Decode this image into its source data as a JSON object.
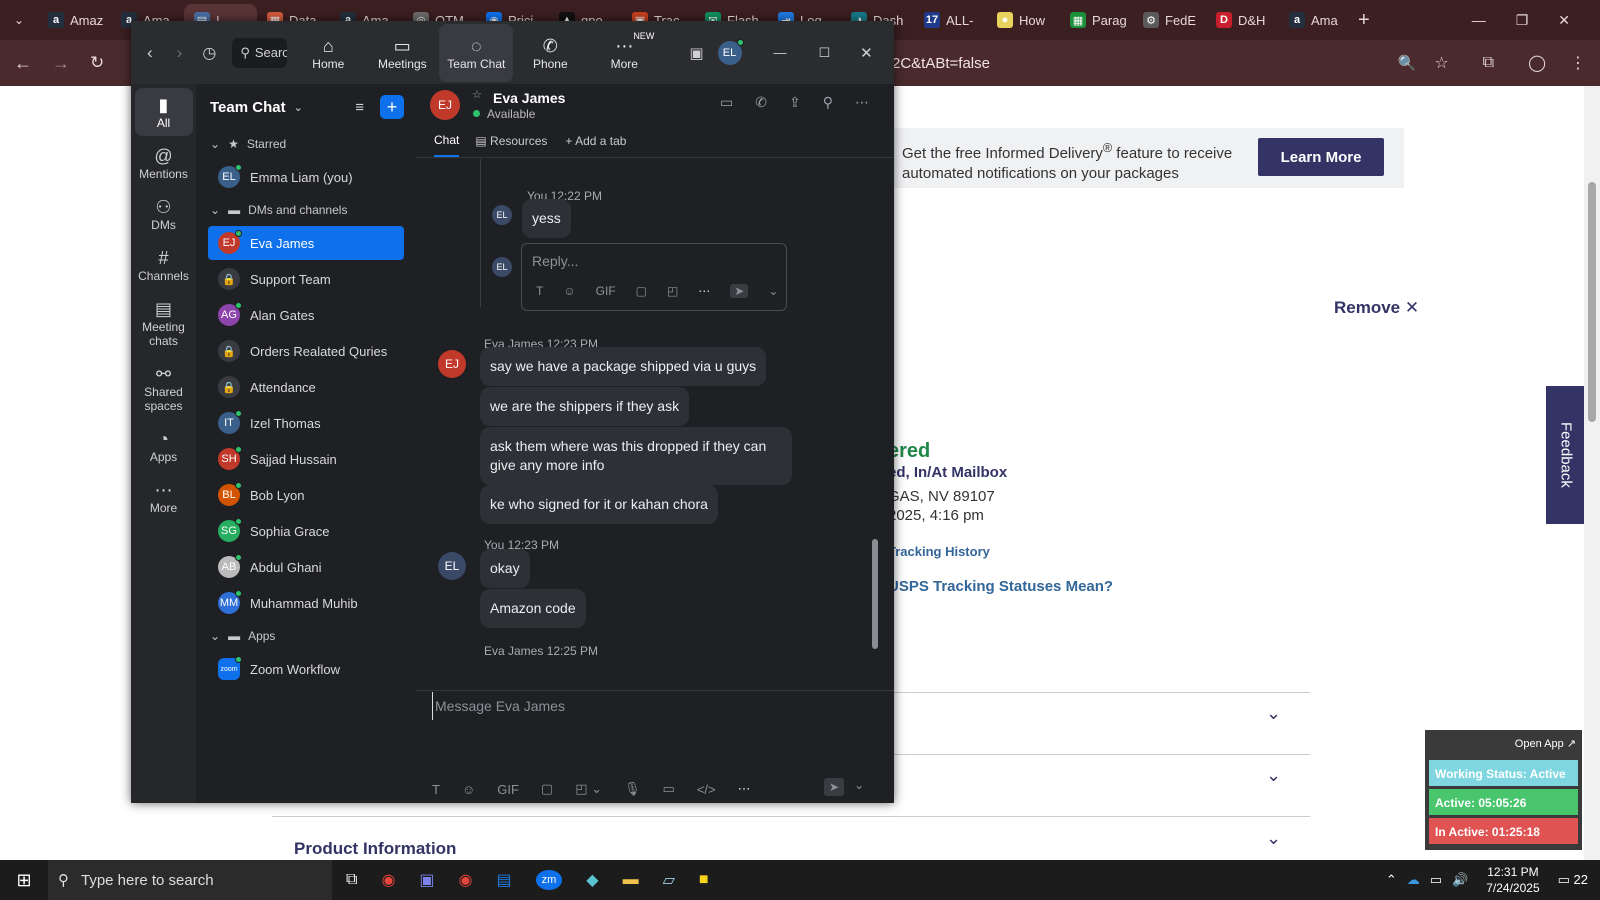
{
  "browser": {
    "tabs": [
      {
        "label": "Amaz",
        "icon": "a",
        "color": "#232f3e"
      },
      {
        "label": "Ama",
        "icon": "a",
        "color": "#232f3e"
      },
      {
        "label": "I",
        "icon": "▤",
        "color": "#4a6fa5"
      },
      {
        "label": "Data",
        "icon": "▦",
        "color": "#d35b3c"
      },
      {
        "label": "Ama",
        "icon": "a",
        "color": "#232f3e"
      },
      {
        "label": "OTM",
        "icon": "◎",
        "color": "#6a6a6a"
      },
      {
        "label": "Prici",
        "icon": "◉",
        "color": "#0e71eb"
      },
      {
        "label": "gpo",
        "icon": "▲",
        "color": "#111"
      },
      {
        "label": "Trac",
        "icon": "▣",
        "color": "#c7401f"
      },
      {
        "label": "Flash",
        "icon": "✉",
        "color": "#0f8f5f"
      },
      {
        "label": "Log",
        "icon": "⇥",
        "color": "#1f7ae0"
      },
      {
        "label": "Dash",
        "icon": "◑",
        "color": "#177a8a"
      },
      {
        "label": "ALL-",
        "icon": "17",
        "color": "#1e3a8a"
      },
      {
        "label": "How",
        "icon": "●",
        "color": "#e8d35e"
      },
      {
        "label": "Parag",
        "icon": "▦",
        "color": "#1b8f3a"
      },
      {
        "label": "FedE",
        "icon": "⚙",
        "color": "#5a5a5a"
      },
      {
        "label": "D&H",
        "icon": "D",
        "color": "#c91f2e"
      },
      {
        "label": "Ama",
        "icon": "a",
        "color": "#232f3e"
      }
    ],
    "url": "2C&tABt=false"
  },
  "page": {
    "banner_text_1": "Get the free Informed Delivery",
    "banner_reg": "®",
    "banner_text_2": " feature to receive",
    "banner_text_3": "automated notifications on your packages",
    "learn_more": "Learn More",
    "remove": "Remove ✕",
    "status": "ered",
    "status_detail": "ed, In/At Mailbox",
    "location": "GAS, NV 89107",
    "date": "2025, 4:16 pm",
    "tracking_history": "Tracking History",
    "statuses_link": "USPS Tracking Statuses Mean?",
    "product_info": "Product Information",
    "feedback": "Feedback"
  },
  "widget": {
    "open_app": "Open App ↗",
    "working": "Working Status: Active",
    "active": "Active: 05:05:26",
    "inactive": "In Active: 01:25:18"
  },
  "zoom": {
    "search_placeholder": "Search",
    "nav": [
      {
        "label": "Home",
        "icon": "⌂"
      },
      {
        "label": "Meetings",
        "icon": "▭"
      },
      {
        "label": "Team Chat",
        "icon": "◌"
      },
      {
        "label": "Phone",
        "icon": "✆"
      },
      {
        "label": "More",
        "icon": "⋯"
      }
    ],
    "new_badge": "NEW",
    "me_initials": "EL",
    "rail": [
      {
        "label": "All",
        "icon": "▮"
      },
      {
        "label": "Mentions",
        "icon": "@"
      },
      {
        "label": "DMs",
        "icon": "⚇"
      },
      {
        "label": "Channels",
        "icon": "#"
      },
      {
        "label": "Meeting chats",
        "icon": "▤"
      },
      {
        "label": "Shared spaces",
        "icon": "⚯"
      },
      {
        "label": "Apps",
        "icon": "◔"
      },
      {
        "label": "More",
        "icon": "⋯"
      }
    ],
    "sidebar_title": "Team Chat",
    "sections": {
      "starred": "Starred",
      "dms": "DMs and channels",
      "apps": "Apps"
    },
    "starred": [
      {
        "name": "Emma Liam (you)",
        "initials": "EL",
        "color": "#3a5f8a"
      }
    ],
    "dms": [
      {
        "name": "Eva James",
        "initials": "EJ",
        "color": "#c0392b"
      },
      {
        "name": "Support Team",
        "initials": "🔒",
        "color": "#3a3b40"
      },
      {
        "name": "Alan Gates",
        "initials": "AG",
        "color": "#8e44ad"
      },
      {
        "name": "Orders Realated Quries",
        "initials": "🔒",
        "color": "#3a3b40"
      },
      {
        "name": "Attendance",
        "initials": "🔒",
        "color": "#3a3b40"
      },
      {
        "name": "Izel Thomas",
        "initials": "IT",
        "color": "#3a5f8a"
      },
      {
        "name": "Sajjad Hussain",
        "initials": "SH",
        "color": "#c0392b"
      },
      {
        "name": "Bob Lyon",
        "initials": "BL",
        "color": "#d35400"
      },
      {
        "name": "Sophia Grace",
        "initials": "SG",
        "color": "#27ae60"
      },
      {
        "name": "Abdul Ghani",
        "initials": "AB",
        "color": "#bbb"
      },
      {
        "name": "Muhammad Muhib",
        "initials": "MM",
        "color": "#2e6fd8"
      }
    ],
    "apps": [
      {
        "name": "Zoom Workflow",
        "initials": "zoom",
        "color": "#0e71eb"
      }
    ],
    "contact": {
      "name": "Eva James",
      "status": "Available",
      "initials": "EJ"
    },
    "tabs": {
      "chat": "Chat",
      "resources": "Resources",
      "add": "Add a tab"
    },
    "thread_meta": "You 12:22 PM",
    "thread_msg": "yess",
    "reply_placeholder": "Reply...",
    "msg_group1_meta": "Eva James 12:23 PM",
    "msgs1": [
      "say we have a package shipped via u guys",
      "we are the shippers if they ask",
      "ask them where was this dropped if they can give any more info",
      "ke who signed for it or kahan chora"
    ],
    "msg_group2_meta": "You 12:23 PM",
    "msgs2": [
      "okay",
      "Amazon code"
    ],
    "msg_group3_meta": "Eva James 12:25 PM",
    "composer_placeholder": "Message Eva James",
    "gif": "GIF"
  },
  "taskbar": {
    "search": "Type here to search",
    "time": "12:31 PM",
    "date": "7/24/2025",
    "notif": "22"
  }
}
